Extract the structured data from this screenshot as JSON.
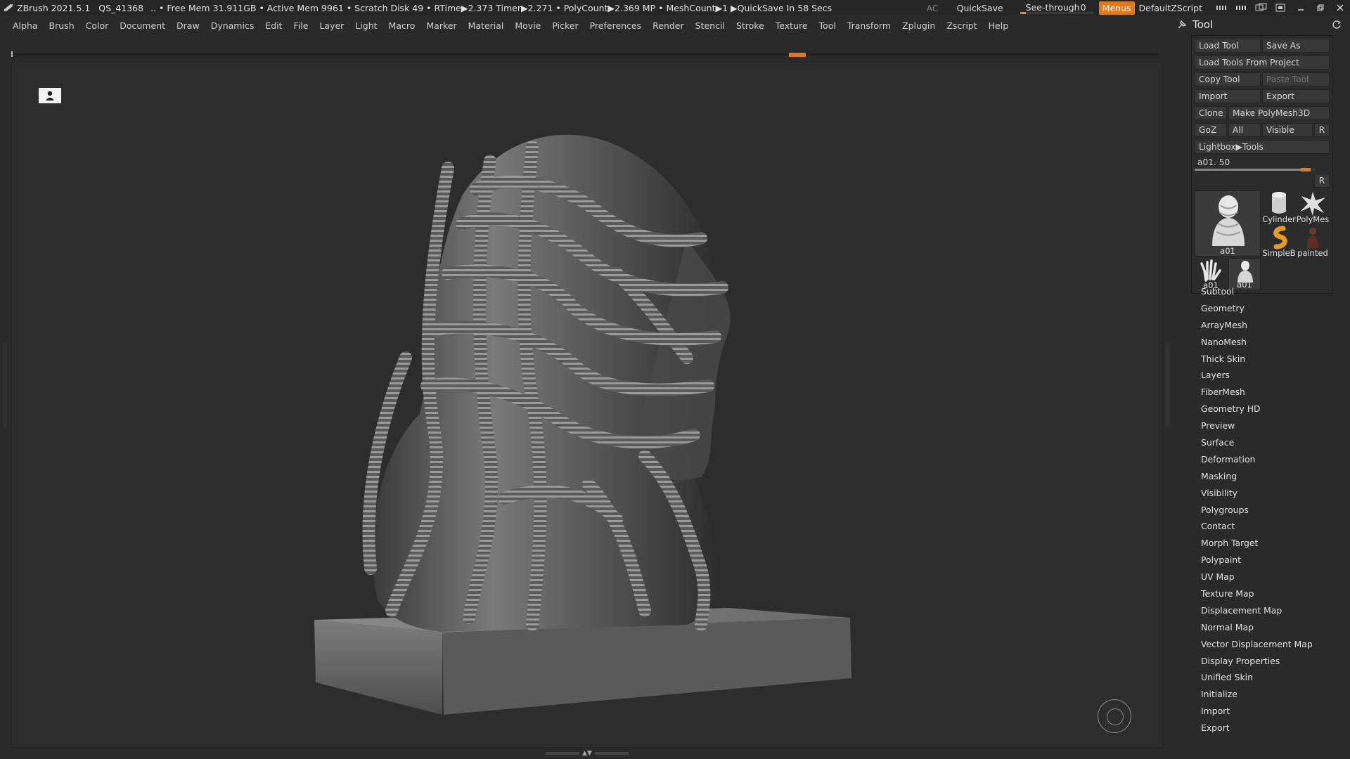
{
  "titlebar": {
    "app": "ZBrush 2021.5.1",
    "quicksave_id": "QS_41368",
    "status": ".. • Free Mem 31.911GB • Active Mem 9961 • Scratch Disk 49 • RTime▶2.373 Timer▶2.271 • PolyCount▶2.369 MP • MeshCount▶1 ▶QuickSave In 58 Secs",
    "ac_label": "AC",
    "quicksave_label": "QuickSave",
    "seethrough_label": "See-through",
    "seethrough_value": "0",
    "menus_label": "Menus",
    "default_zscript_label": "DefaultZScript",
    "colors": {
      "accent": "#e07a1a",
      "bar": "#262626"
    }
  },
  "menubar": {
    "items": [
      "Alpha",
      "Brush",
      "Color",
      "Document",
      "Draw",
      "Dynamics",
      "Edit",
      "File",
      "Layer",
      "Light",
      "Macro",
      "Marker",
      "Material",
      "Movie",
      "Picker",
      "Preferences",
      "Render",
      "Stencil",
      "Stroke",
      "Texture",
      "Tool",
      "Transform",
      "Zplugin",
      "Zscript",
      "Help"
    ]
  },
  "tool": {
    "title": "Tool",
    "buttons": {
      "load_tool": "Load Tool",
      "save_as": "Save As",
      "load_from_project": "Load Tools From Project",
      "copy_tool": "Copy Tool",
      "paste_tool": "Paste Tool",
      "import": "Import",
      "export": "Export",
      "clone": "Clone",
      "make_polymesh": "Make PolyMesh3D",
      "goz": "GoZ",
      "all": "All",
      "visible": "Visible",
      "r": "R",
      "lightbox_tools": "Lightbox▶Tools"
    },
    "active_tool_slider": {
      "label": "a01. 50",
      "value_fraction": 0.92,
      "r_label": "R"
    },
    "thumbnails": [
      {
        "name": "a01",
        "icon": "bust-icon"
      },
      {
        "name": "Cylinder",
        "icon": "cylinder-icon"
      },
      {
        "name": "PolyMes",
        "icon": "star-icon"
      },
      {
        "name": "SimpleB",
        "icon": "simplebrush-icon"
      },
      {
        "name": "painted",
        "icon": "painted-figure-icon"
      },
      {
        "name": "a01",
        "icon": "hand-icon"
      },
      {
        "name": "a01",
        "icon": "small-bust-icon"
      }
    ],
    "subpalettes": [
      "Subtool",
      "Geometry",
      "ArrayMesh",
      "NanoMesh",
      "Thick Skin",
      "Layers",
      "FiberMesh",
      "Geometry HD",
      "Preview",
      "Surface",
      "Deformation",
      "Masking",
      "Visibility",
      "Polygroups",
      "Contact",
      "Morph Target",
      "Polypaint",
      "UV Map",
      "Texture Map",
      "Displacement Map",
      "Normal Map",
      "Vector Displacement Map",
      "Display Properties",
      "Unified Skin",
      "Initialize",
      "Import",
      "Export"
    ]
  }
}
